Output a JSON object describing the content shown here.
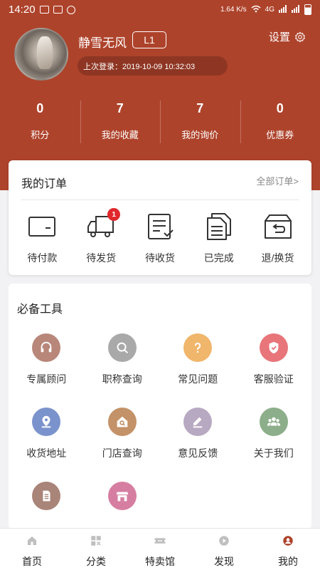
{
  "status_bar": {
    "time": "14:20",
    "net_speed": "1.64 K/s",
    "network": "4G"
  },
  "profile": {
    "username": "静雪无风",
    "level": "L1",
    "last_login": "上次登录：2019-10-09 10:32:03",
    "settings_label": "设置"
  },
  "stats": [
    {
      "value": "0",
      "label": "积分"
    },
    {
      "value": "7",
      "label": "我的收藏"
    },
    {
      "value": "7",
      "label": "我的询价"
    },
    {
      "value": "0",
      "label": "优惠券"
    }
  ],
  "orders": {
    "title": "我的订单",
    "all_label": "全部订单>",
    "items": [
      {
        "label": "待付款",
        "icon": "wallet-icon"
      },
      {
        "label": "待发货",
        "icon": "truck-icon",
        "badge": "1"
      },
      {
        "label": "待收货",
        "icon": "receive-doc-icon"
      },
      {
        "label": "已完成",
        "icon": "completed-doc-icon"
      },
      {
        "label": "退/换货",
        "icon": "return-box-icon"
      }
    ]
  },
  "tools": {
    "title": "必备工具",
    "items": [
      {
        "label": "专属顾问",
        "icon": "headset-icon",
        "color": "#b8877a"
      },
      {
        "label": "职称查询",
        "icon": "search-icon",
        "color": "#a9a9a9"
      },
      {
        "label": "常见问题",
        "icon": "question-icon",
        "color": "#f0b66c"
      },
      {
        "label": "客服验证",
        "icon": "shield-check-icon",
        "color": "#e8757a"
      },
      {
        "label": "收货地址",
        "icon": "location-icon",
        "color": "#7b93cc"
      },
      {
        "label": "门店查询",
        "icon": "store-search-icon",
        "color": "#c49268"
      },
      {
        "label": "意见反馈",
        "icon": "feedback-pen-icon",
        "color": "#b8a9c2"
      },
      {
        "label": "关于我们",
        "icon": "people-icon",
        "color": "#8cae8a"
      },
      {
        "label": "",
        "icon": "document-icon",
        "color": "#a98478"
      },
      {
        "label": "",
        "icon": "shop-icon",
        "color": "#d67ea1"
      }
    ]
  },
  "tabbar": {
    "items": [
      {
        "label": "首页",
        "icon": "home-icon"
      },
      {
        "label": "分类",
        "icon": "category-icon"
      },
      {
        "label": "特卖馆",
        "icon": "ticket-icon"
      },
      {
        "label": "发现",
        "icon": "discover-play-icon"
      },
      {
        "label": "我的",
        "icon": "profile-icon",
        "active": true
      }
    ],
    "active_color": "#ae432b"
  }
}
